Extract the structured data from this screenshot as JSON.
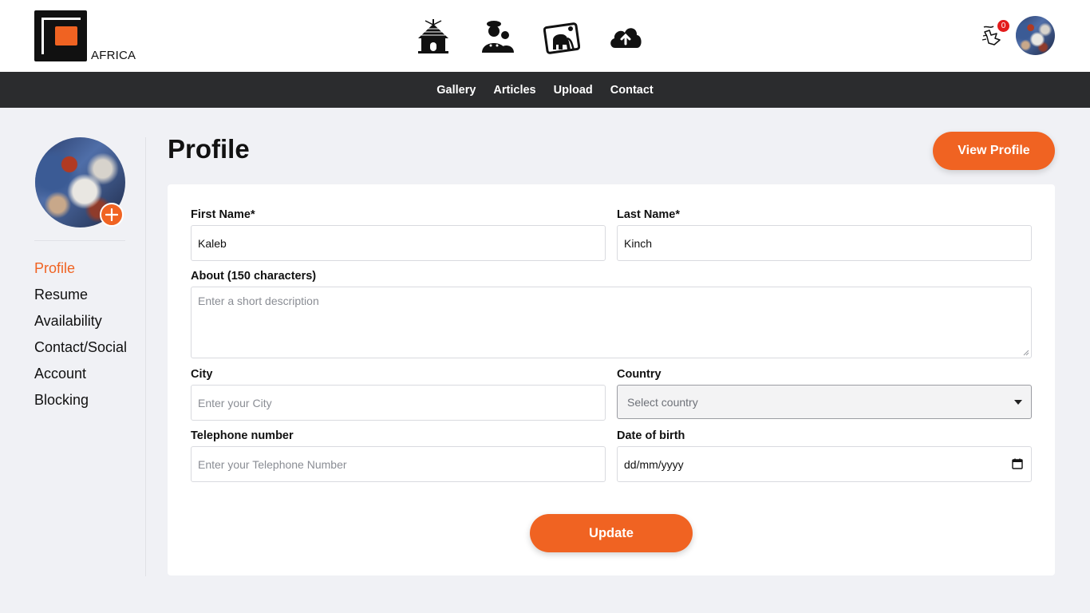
{
  "brand": {
    "logo_text": "AFRICA"
  },
  "header": {
    "icons": [
      "hut-icon",
      "people-icon",
      "elephant-picture-icon",
      "cloud-upload-icon"
    ],
    "notifications": {
      "icon": "notification-icon",
      "count": "0"
    }
  },
  "nav": {
    "links": [
      "Gallery",
      "Articles",
      "Upload",
      "Contact"
    ]
  },
  "sidebar": {
    "items": [
      {
        "label": "Profile",
        "active": true
      },
      {
        "label": "Resume",
        "active": false
      },
      {
        "label": "Availability",
        "active": false
      },
      {
        "label": "Contact/Social",
        "active": false
      },
      {
        "label": "Account",
        "active": false
      },
      {
        "label": "Blocking",
        "active": false
      }
    ]
  },
  "page": {
    "title": "Profile",
    "view_profile_label": "View Profile"
  },
  "form": {
    "first_name": {
      "label": "First Name*",
      "value": "Kaleb"
    },
    "last_name": {
      "label": "Last Name*",
      "value": "Kinch"
    },
    "about": {
      "label": "About (150 characters)",
      "placeholder": "Enter a short description"
    },
    "city": {
      "label": "City",
      "placeholder": "Enter your City"
    },
    "country": {
      "label": "Country",
      "placeholder": "Select country"
    },
    "telephone": {
      "label": "Telephone number",
      "placeholder": "Enter your Telephone Number"
    },
    "dob": {
      "label": "Date of birth",
      "value": "dd/mm/yyyy"
    },
    "update_label": "Update"
  },
  "colors": {
    "accent": "#f06322",
    "navbar": "#2b2c2e",
    "background": "#f0f1f5",
    "badge": "#e31b1b"
  }
}
